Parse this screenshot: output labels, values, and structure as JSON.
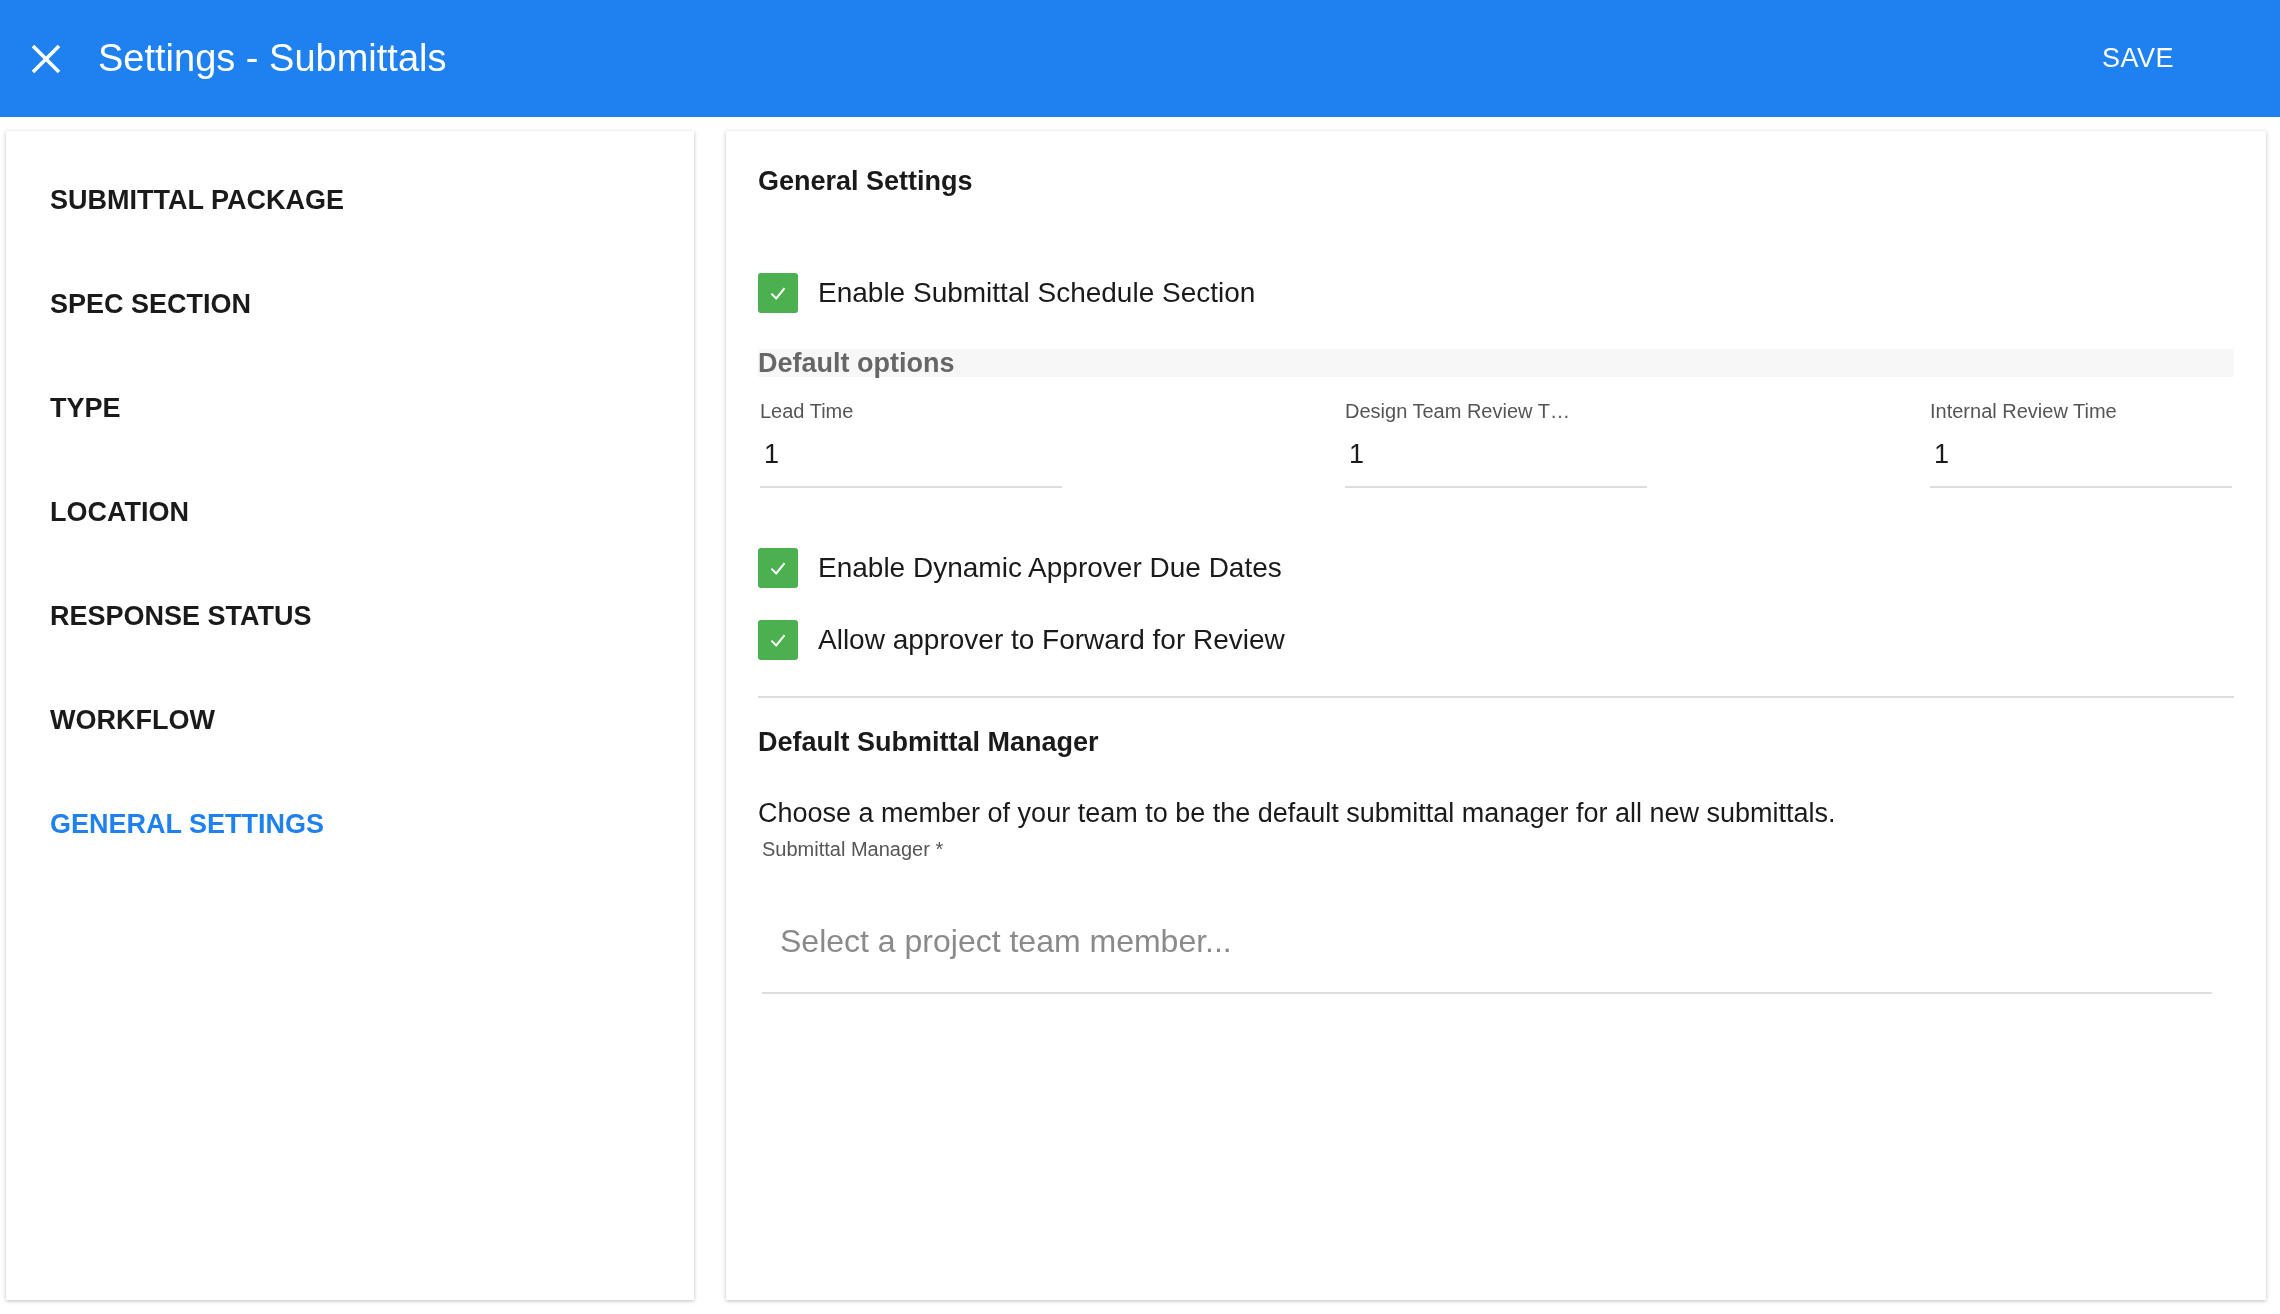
{
  "header": {
    "title": "Settings - Submittals",
    "save_button": "SAVE"
  },
  "sidebar": {
    "items": [
      {
        "label": "SUBMITTAL PACKAGE",
        "selected": false
      },
      {
        "label": "SPEC SECTION",
        "selected": false
      },
      {
        "label": "TYPE",
        "selected": false
      },
      {
        "label": "LOCATION",
        "selected": false
      },
      {
        "label": "RESPONSE STATUS",
        "selected": false
      },
      {
        "label": "WORKFLOW",
        "selected": false
      },
      {
        "label": "GENERAL SETTINGS",
        "selected": true
      }
    ]
  },
  "general_settings": {
    "title": "General Settings",
    "schedule_checkbox": {
      "label": "Enable Submittal Schedule Section",
      "checked": true
    },
    "default_options": {
      "title": "Default options",
      "fields": [
        {
          "label": "Lead Time",
          "value": "1"
        },
        {
          "label": "Design Team Review T…",
          "value": "1"
        },
        {
          "label": "Internal Review Time",
          "value": "1"
        }
      ]
    },
    "checkboxes": [
      {
        "label": "Enable Dynamic Approver Due Dates",
        "checked": true
      },
      {
        "label": "Allow approver to Forward for Review",
        "checked": true
      }
    ]
  },
  "submittal_manager": {
    "title": "Default Submittal Manager",
    "description": "Choose a member of your team to be the default submittal manager for all new submittals.",
    "field": {
      "label": "Submittal Manager *",
      "placeholder": "Select a project team member..."
    }
  }
}
